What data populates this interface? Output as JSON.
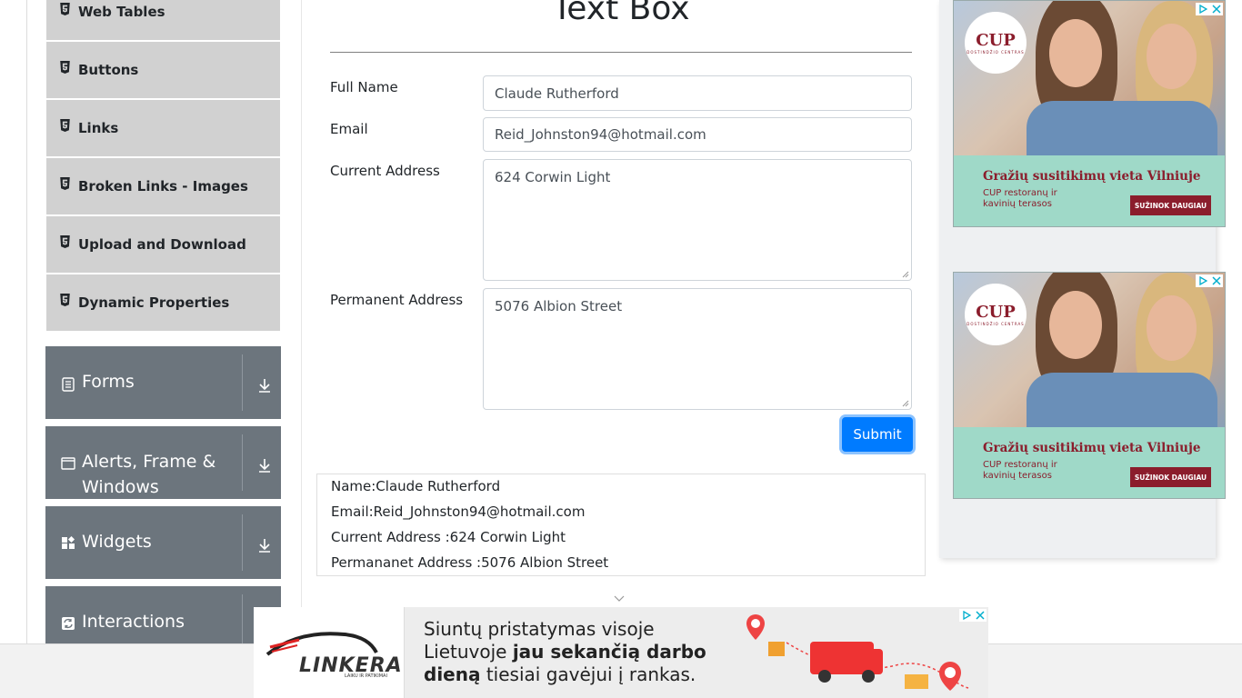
{
  "sidebar": {
    "elements_items": [
      {
        "label": "Web Tables"
      },
      {
        "label": "Buttons"
      },
      {
        "label": "Links"
      },
      {
        "label": "Broken Links - Images"
      },
      {
        "label": "Upload and Download"
      },
      {
        "label": "Dynamic Properties"
      }
    ],
    "groups": [
      {
        "label_line1": "Forms",
        "label_line2": "",
        "icon": "form-icon"
      },
      {
        "label_line1": "Alerts, Frame &",
        "label_line2": "Windows",
        "icon": "window-icon"
      },
      {
        "label_line1": "Widgets",
        "label_line2": "",
        "icon": "widgets-icon"
      },
      {
        "label_line1": "Interactions",
        "label_line2": "",
        "icon": "interactions-icon"
      }
    ]
  },
  "main": {
    "title": "Text Box",
    "form": {
      "full_name_label": "Full Name",
      "full_name_value": "Claude Rutherford",
      "email_label": "Email",
      "email_value": "Reid_Johnston94@hotmail.com",
      "current_address_label": "Current Address",
      "current_address_value": "624 Corwin Light",
      "permanent_address_label": "Permanent Address",
      "permanent_address_value": "5076 Albion Street",
      "submit_label": "Submit"
    },
    "output": {
      "name": "Name:Claude Rutherford",
      "email": "Email:Reid_Johnston94@hotmail.com",
      "current_address": "Current Address :624 Corwin Light",
      "permanent_address": "Permananet Address :5076 Albion Street"
    }
  },
  "ads": {
    "side": {
      "logo": "CUP",
      "logo_sub": "DOSTINDŽIO CENTRAS",
      "headline": "Gražių susitikimų vieta Vilniuje",
      "subtext": "CUP restoranų ir kavinių terasos",
      "cta": "SUŽINOK DAUGIAU"
    },
    "banner": {
      "brand": "LINKERA",
      "brand_tag": "LAIKU IR PATIKIMAI",
      "line1": "Siuntų pristatymas visoje",
      "line2_plain": "Lietuvoje ",
      "line2_bold": "jau sekančią darbo",
      "line3_bold": "dieną",
      "line3_plain": " tiesiai gavėjui į rankas."
    }
  },
  "colors": {
    "primary": "#007bff",
    "menu_item_bg": "#d1d1d1",
    "group_bg": "#6c757d",
    "ad_accent": "#8b1d2c",
    "ad_mint": "#9fd9c8"
  }
}
